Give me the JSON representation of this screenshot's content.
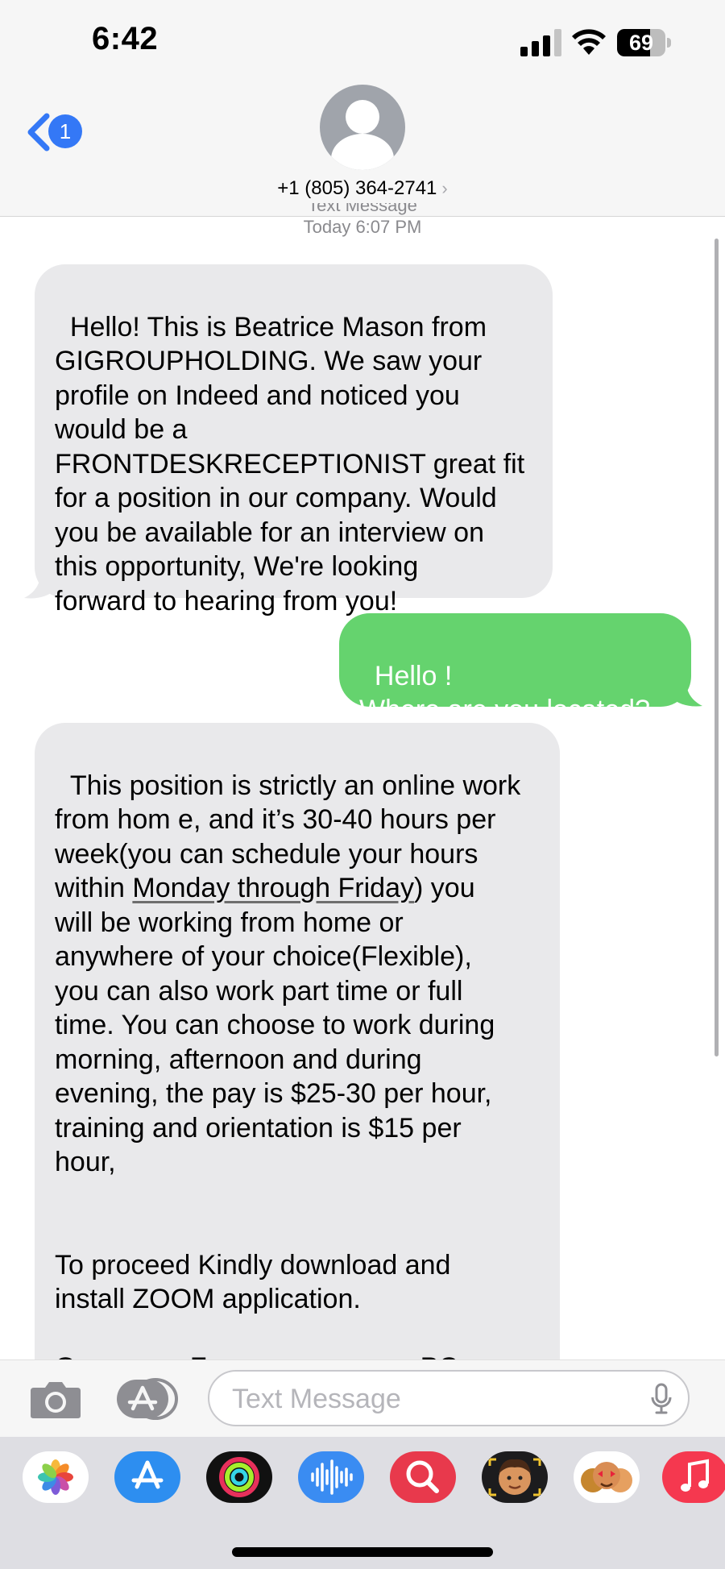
{
  "status_bar": {
    "time": "6:42",
    "signal_bars": 3,
    "battery_level": 69,
    "battery_text": "69"
  },
  "header": {
    "back_badge": "1",
    "contact_name": "+1 (805) 364-2741",
    "contact_chevron": "›"
  },
  "thread": {
    "service_label": "Text Message",
    "timestamp": "Today 6:07 PM",
    "messages": [
      {
        "direction": "incoming",
        "text": "Hello! This is Beatrice Mason from\nGIGROUPHOLDING. We saw your\nprofile on Indeed and noticed you\nwould be a\nFRONTDESKRECEPTIONIST great fit\nfor a position in our company. Would\nyou be available for an interview on\nthis opportunity, We're looking\nforward to hearing from you!"
      },
      {
        "direction": "outgoing",
        "text": "Hello !\nWhere are you located?"
      },
      {
        "direction": "incoming",
        "text_before_link": "This position is strictly an online work\nfrom hom e, and it’s 30-40 hours per\nweek(you can schedule your hours\nwithin ",
        "link_text": "Monday through Friday",
        "text_after_link": ") you\nwill be working from home or\nanywhere of your choice(Flexible),\nyou can also work part time or full\ntime. You can choose to work during\nmorning, afternoon and during\nevening, the pay is $25-30 per hour,\ntraining and orientation is $15 per\nhour,\n\n\nTo proceed Kindly download and\ninstall ZOOM application.\n\nOpen your Zoom app on your PC or"
      }
    ]
  },
  "compose": {
    "placeholder": "Text Message",
    "value": ""
  },
  "app_drawer": {
    "apps": [
      "photos-icon",
      "app-store-icon",
      "fitness-icon",
      "audio-message-icon",
      "images-search-icon",
      "memoji-icon",
      "animoji-icon",
      "music-icon"
    ]
  },
  "colors": {
    "incoming_bubble": "#e9e9eb",
    "outgoing_bubble": "#65d36e",
    "accent_blue": "#3478f6",
    "bar_background": "#f6f6f6"
  }
}
